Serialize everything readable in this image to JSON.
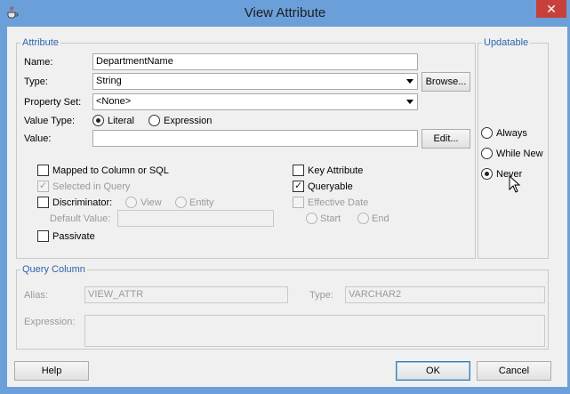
{
  "window": {
    "title": "View Attribute",
    "close_glyph": "✕",
    "app_icon": "java-cup-icon"
  },
  "attribute": {
    "legend": "Attribute",
    "name_label": "Name:",
    "name_value": "DepartmentName",
    "type_label": "Type:",
    "type_value": "String",
    "browse_label": "Browse...",
    "property_set_label": "Property Set:",
    "property_set_value": "<None>",
    "value_type_label": "Value Type:",
    "literal_label": "Literal",
    "expression_label": "Expression",
    "value_label": "Value:",
    "value_value": "",
    "edit_label": "Edit...",
    "mapped_label": "Mapped to Column or SQL",
    "selected_in_query_label": "Selected in Query",
    "discriminator_label": "Discriminator:",
    "view_label": "View",
    "entity_label": "Entity",
    "default_value_label": "Default Value:",
    "passivate_label": "Passivate",
    "key_attribute_label": "Key Attribute",
    "queryable_label": "Queryable",
    "effective_date_label": "Effective Date",
    "start_label": "Start",
    "end_label": "End"
  },
  "updatable": {
    "legend": "Updatable",
    "always_label": "Always",
    "while_new_label": "While New",
    "never_label": "Never"
  },
  "query_column": {
    "legend": "Query Column",
    "alias_label": "Alias:",
    "alias_value": "VIEW_ATTR",
    "type_label": "Type:",
    "type_value": "VARCHAR2",
    "expression_label": "Expression:"
  },
  "footer": {
    "help_label": "Help",
    "ok_label": "OK",
    "cancel_label": "Cancel"
  },
  "colors": {
    "titlebar": "#6b9fd9",
    "legend": "#2d63ad",
    "close": "#c7403a"
  }
}
